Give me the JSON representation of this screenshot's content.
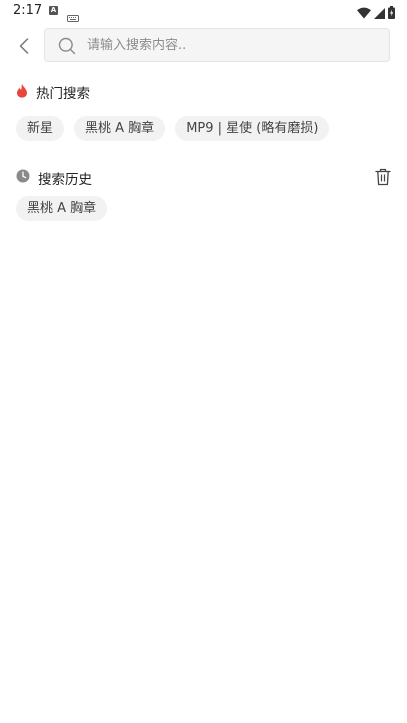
{
  "status_bar": {
    "time": "2:17",
    "a_icon_letter": "A"
  },
  "search": {
    "placeholder": "请输入搜索内容.."
  },
  "hot_search": {
    "title": "热门搜索",
    "tags": [
      "新星",
      "黑桃 A 胸章",
      "MP9 | 星使 (略有磨损)"
    ]
  },
  "history": {
    "title": "搜索历史",
    "tags": [
      "黑桃 A 胸章"
    ]
  },
  "colors": {
    "hot_icon": "#e8453c",
    "history_icon": "#8a8a8e",
    "tag_bg": "#f2f2f3",
    "search_bg": "#f5f5f6"
  }
}
